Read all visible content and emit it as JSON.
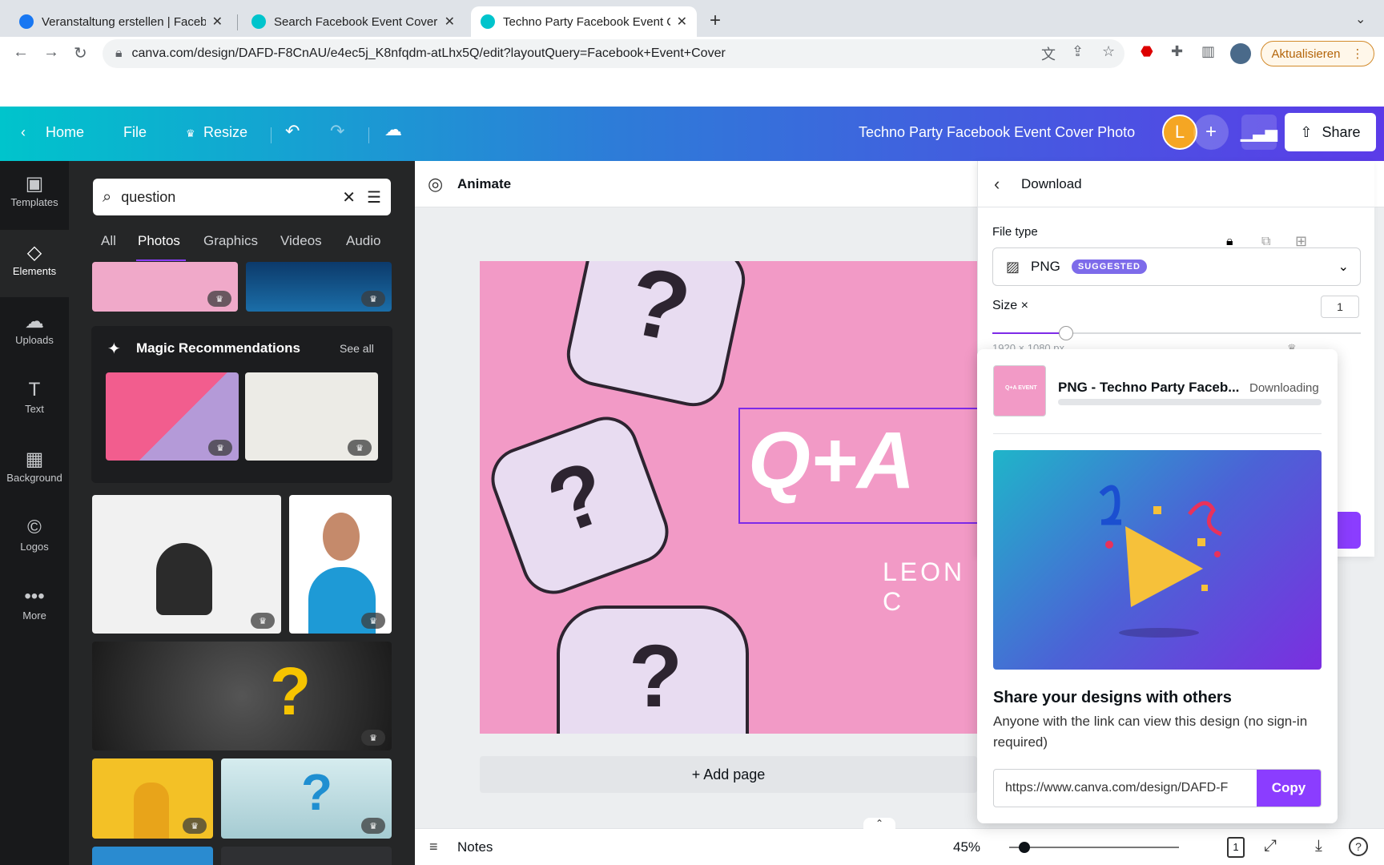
{
  "browser": {
    "tabs": [
      {
        "title": "Veranstaltung erstellen | Faceb",
        "favicon_color": "#1877f2"
      },
      {
        "title": "Search Facebook Event Cover",
        "favicon_color": "#00c4cc"
      },
      {
        "title": "Techno Party Facebook Event C",
        "favicon_color": "#00c4cc"
      }
    ],
    "new_tab": "+",
    "url": "canva.com/design/DAFD-F8CnAU/e4ec5j_K8nfqdm-atLhx5Q/edit?layoutQuery=Facebook+Event+Cover",
    "update_label": "Aktualisieren",
    "tab_close": "✕"
  },
  "header": {
    "home": "Home",
    "file": "File",
    "resize": "Resize",
    "doc_title": "Techno Party Facebook Event Cover Photo",
    "avatar_initial": "L",
    "add": "+",
    "share": "Share"
  },
  "rail": {
    "items": [
      {
        "label": "Templates",
        "icon": "▣"
      },
      {
        "label": "Elements",
        "icon": "◇"
      },
      {
        "label": "Uploads",
        "icon": "☁"
      },
      {
        "label": "Text",
        "icon": "T"
      },
      {
        "label": "Background",
        "icon": "▦"
      },
      {
        "label": "Logos",
        "icon": "©"
      },
      {
        "label": "More",
        "icon": "•••"
      }
    ]
  },
  "panel": {
    "search_value": "question",
    "tabs": [
      "All",
      "Photos",
      "Graphics",
      "Videos",
      "Audio"
    ],
    "magic_title": "Magic Recommendations",
    "see_all": "See all",
    "crown": "♛"
  },
  "toolbar": {
    "animate": "Animate"
  },
  "canvas": {
    "qa_text": "Q+A",
    "leon_text": "LEON C",
    "add_page": "+ Add page",
    "qmark": "?"
  },
  "bottombar": {
    "notes": "Notes",
    "zoom": "45%",
    "page_num": "1"
  },
  "download": {
    "title": "Download",
    "file_type_label": "File type",
    "file_type_value": "PNG",
    "suggested": "SUGGESTED",
    "size_label": "Size ×",
    "size_value": "1",
    "size_hint": "1920 × 1080 px",
    "size_fraction": 0.2
  },
  "share_card": {
    "file_name": "PNG - Techno Party Faceb...",
    "status": "Downloading",
    "thumb_text": "Q+A EVENT",
    "heading": "Share your designs with others",
    "description": "Anyone with the link can view this design (no sign-in required)",
    "link": "https://www.canva.com/design/DAFD-F",
    "copy": "Copy"
  }
}
